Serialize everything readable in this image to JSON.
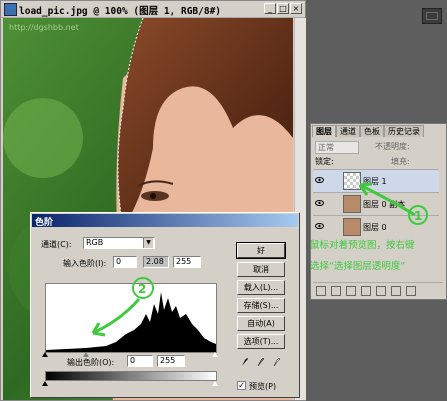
{
  "document": {
    "title": "load_pic.jpg @ 100% (图层 1, RGB/8#)",
    "watermark": "http://dgshbb.net"
  },
  "layers_panel": {
    "tabs": [
      "图层",
      "通道",
      "色板",
      "历史记录"
    ],
    "blend_mode": "正常",
    "opacity_label": "不透明度:",
    "lock_label": "锁定:",
    "fill_label": "填充:",
    "layers": [
      {
        "name": "图层 1",
        "selected": true
      },
      {
        "name": "图层 0 副本",
        "selected": false
      },
      {
        "name": "图层 0",
        "selected": false
      }
    ]
  },
  "levels_dialog": {
    "title": "色阶",
    "channel_label": "通道(C):",
    "channel_value": "RGB",
    "input_label": "输入色阶(I):",
    "input_values": [
      "0",
      "2.08",
      "255"
    ],
    "output_label": "输出色阶(O):",
    "output_values": [
      "0",
      "255"
    ],
    "buttons": [
      "好",
      "取消",
      "载入(L)...",
      "存储(S)...",
      "自动(A)",
      "选项(T)..."
    ],
    "preview_label": "预览(P)",
    "preview_checked": true
  },
  "annotations": {
    "marker_1": "1",
    "marker_2": "2",
    "line1": "鼠标对着预览图，按右键",
    "line2": "选择“选择图层透明度”"
  },
  "colors": {
    "annotation": "#3fc93f",
    "title_blue": "#0a246a"
  }
}
